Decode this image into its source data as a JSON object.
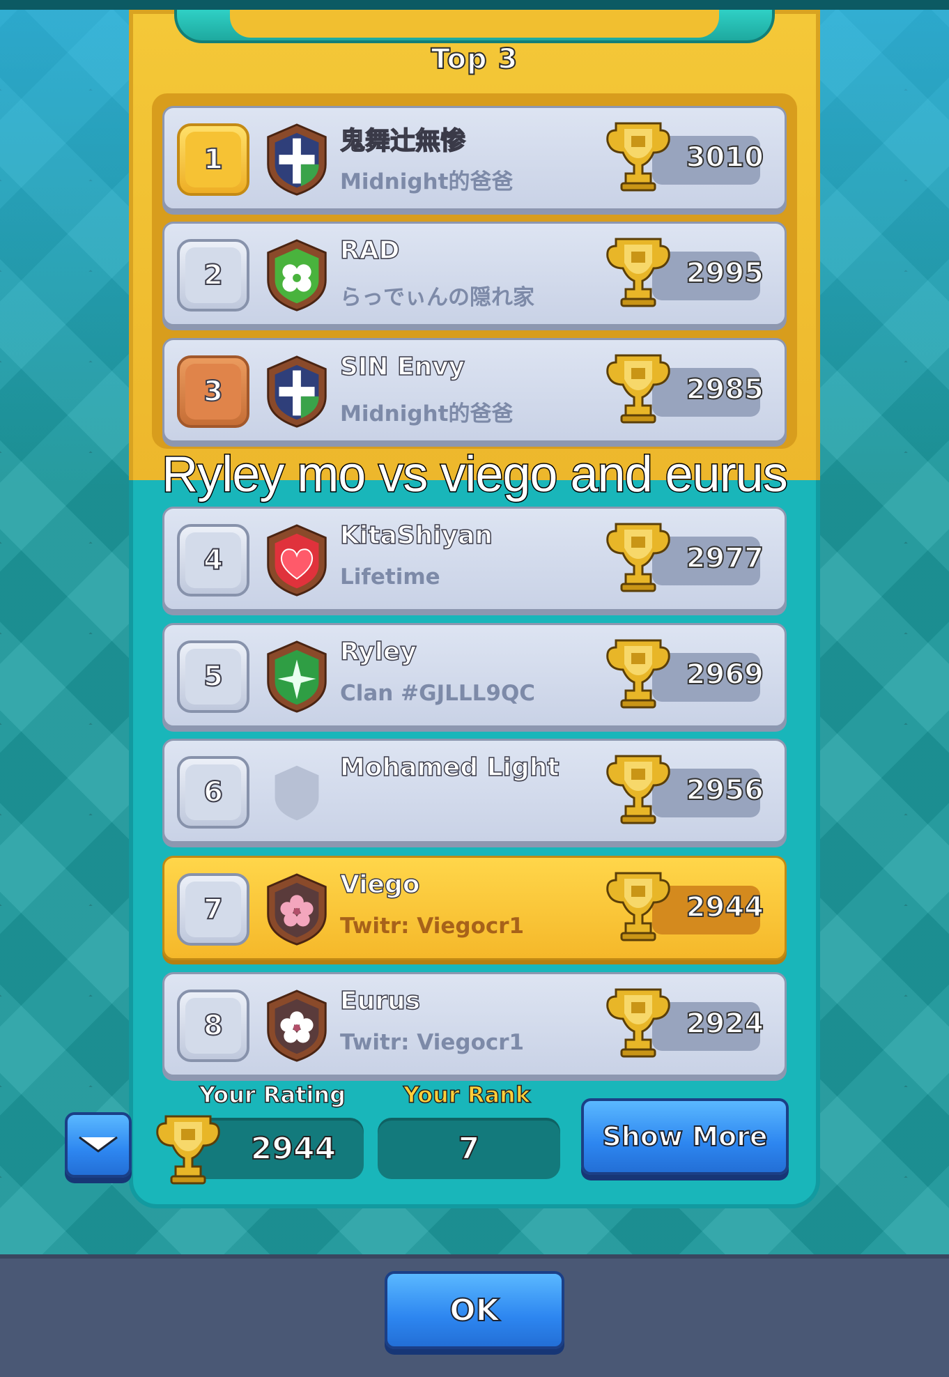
{
  "section_title": "Top 3",
  "caption": "Ryley mo vs viego and eurus",
  "rows": [
    {
      "rank": "1",
      "name": "鬼舞辻無惨",
      "clan": "Midnight的爸爸",
      "trophies": "3010",
      "badge": "cross-shield-icon",
      "badge_color": "#2f3f7a"
    },
    {
      "rank": "2",
      "name": "RAD",
      "clan": "らっでぃんの隠れ家",
      "trophies": "2995",
      "badge": "clover-shield-icon",
      "badge_color": "#49b33d"
    },
    {
      "rank": "3",
      "name": "SIN Envy",
      "clan": "Midnight的爸爸",
      "trophies": "2985",
      "badge": "cross-shield-icon",
      "badge_color": "#2f3f7a"
    },
    {
      "rank": "4",
      "name": "KitaShiyan",
      "clan": "Lifetime",
      "trophies": "2977",
      "badge": "heart-shield-icon",
      "badge_color": "#e0323c"
    },
    {
      "rank": "5",
      "name": "Ryley",
      "clan": "Clan #GJLLL9QC",
      "trophies": "2969",
      "badge": "star-shield-icon",
      "badge_color": "#2f9e44"
    },
    {
      "rank": "6",
      "name": "Mohamed Light",
      "clan": "",
      "trophies": "2956",
      "badge": "empty-shield-icon",
      "badge_color": "#a9b3c8"
    },
    {
      "rank": "7",
      "name": "Viego",
      "clan": "Twitr: Viegocr1",
      "trophies": "2944",
      "badge": "flower-shield-icon",
      "badge_color": "#f3a6bd"
    },
    {
      "rank": "8",
      "name": "Eurus",
      "clan": "Twitr: Viegocr1",
      "trophies": "2924",
      "badge": "flower-shield-icon",
      "badge_color": "#ffffff"
    }
  ],
  "footer": {
    "rating_label": "Your Rating",
    "rating_value": "2944",
    "rank_label": "Your Rank",
    "rank_value": "7",
    "show_more_label": "Show More"
  },
  "ok_label": "OK",
  "colors": {
    "gold_panel": "#f4c838",
    "teal_panel": "#19b6ba",
    "button_blue": "#2d86f0",
    "highlight_row": "#ffd64a"
  }
}
